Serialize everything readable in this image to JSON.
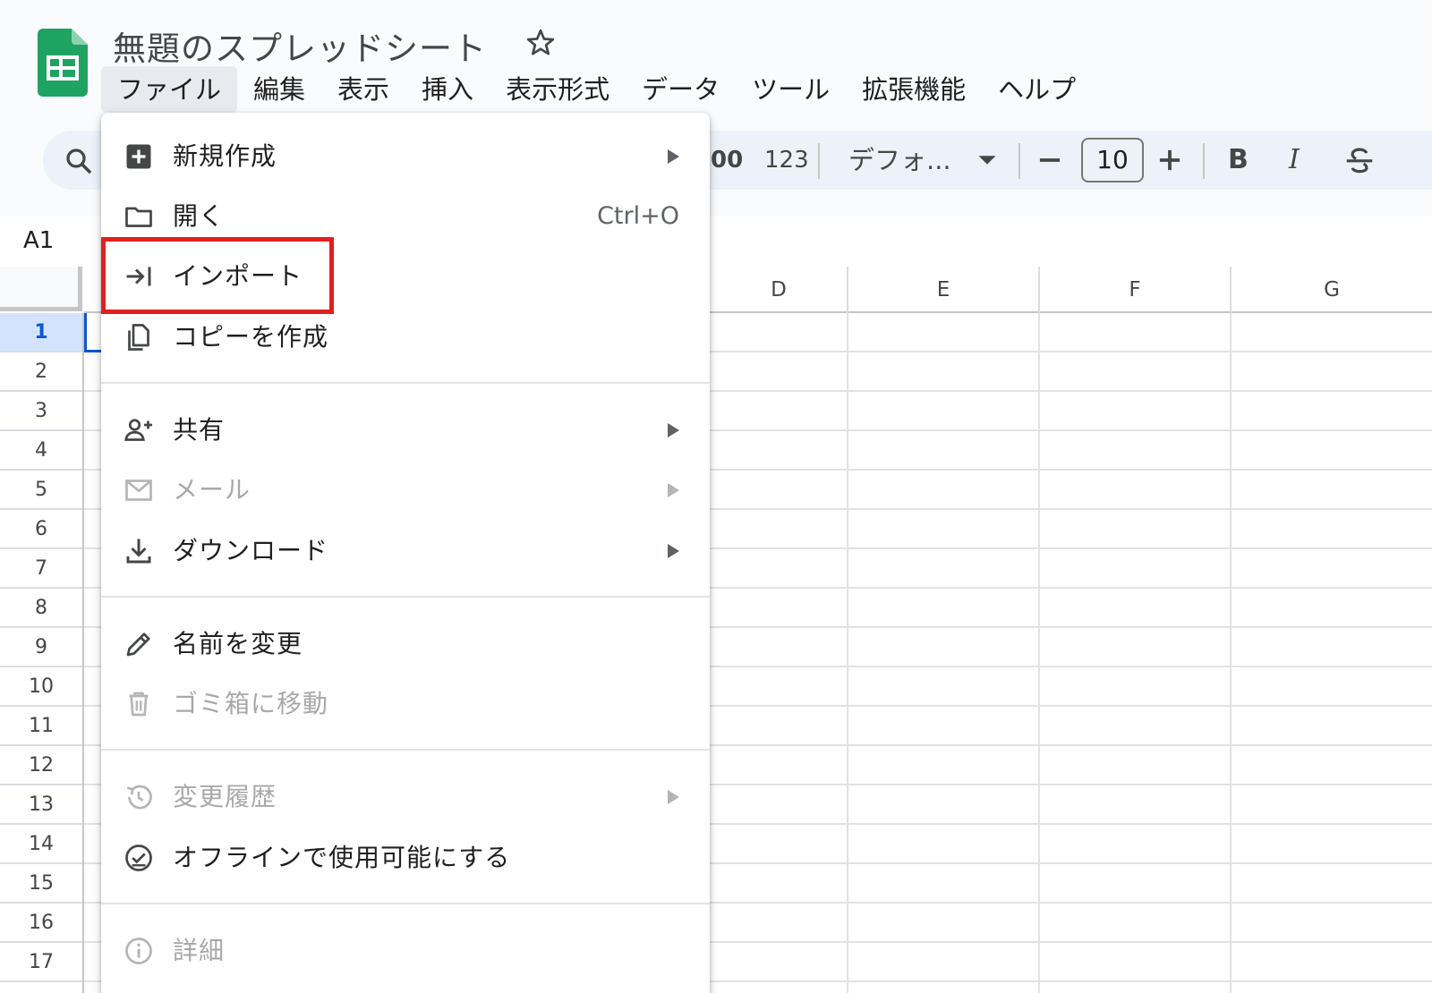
{
  "header": {
    "doc_title": "無題のスプレッドシート",
    "logo_icon": "google-sheets-logo",
    "brand_color": "#1ea362"
  },
  "menu_bar": {
    "items": [
      {
        "label": "ファイル",
        "active": true
      },
      {
        "label": "編集"
      },
      {
        "label": "表示"
      },
      {
        "label": "挿入"
      },
      {
        "label": "表示形式"
      },
      {
        "label": "データ"
      },
      {
        "label": "ツール"
      },
      {
        "label": "拡張機能"
      },
      {
        "label": "ヘルプ"
      }
    ]
  },
  "toolbar": {
    "decimal_label": "00",
    "number_format_label": "123",
    "font_name": "デフォ...",
    "font_size": "10",
    "bold_label": "B",
    "italic_label": "I"
  },
  "formula_bar": {
    "name_box": "A1"
  },
  "grid": {
    "columns": [
      "D",
      "E",
      "F",
      "G"
    ],
    "rows": [
      "1",
      "2",
      "3",
      "4",
      "5",
      "6",
      "7",
      "8",
      "9",
      "10",
      "11",
      "12",
      "13",
      "14",
      "15",
      "16",
      "17"
    ],
    "selected_row": "1"
  },
  "file_menu": {
    "items": [
      {
        "label": "新規作成",
        "icon": "new-spreadsheet-icon",
        "submenu": true,
        "disabled": false
      },
      {
        "label": "開く",
        "icon": "folder-icon",
        "shortcut": "Ctrl+O",
        "disabled": false
      },
      {
        "label": "インポート",
        "icon": "import-icon",
        "disabled": false,
        "highlighted": true
      },
      {
        "label": "コピーを作成",
        "icon": "copy-icon",
        "disabled": false
      },
      {
        "label": "共有",
        "icon": "share-person-icon",
        "submenu": true,
        "disabled": false
      },
      {
        "label": "メール",
        "icon": "mail-icon",
        "submenu": true,
        "disabled": true
      },
      {
        "label": "ダウンロード",
        "icon": "download-icon",
        "submenu": true,
        "disabled": false
      },
      {
        "label": "名前を変更",
        "icon": "pencil-icon",
        "disabled": false
      },
      {
        "label": "ゴミ箱に移動",
        "icon": "trash-icon",
        "disabled": true
      },
      {
        "label": "変更履歴",
        "icon": "history-icon",
        "submenu": true,
        "disabled": true
      },
      {
        "label": "オフラインで使用可能にする",
        "icon": "offline-check-icon",
        "disabled": false
      },
      {
        "label": "詳細",
        "icon": "info-icon",
        "disabled": true
      }
    ],
    "highlight_color": "#e0201f"
  }
}
